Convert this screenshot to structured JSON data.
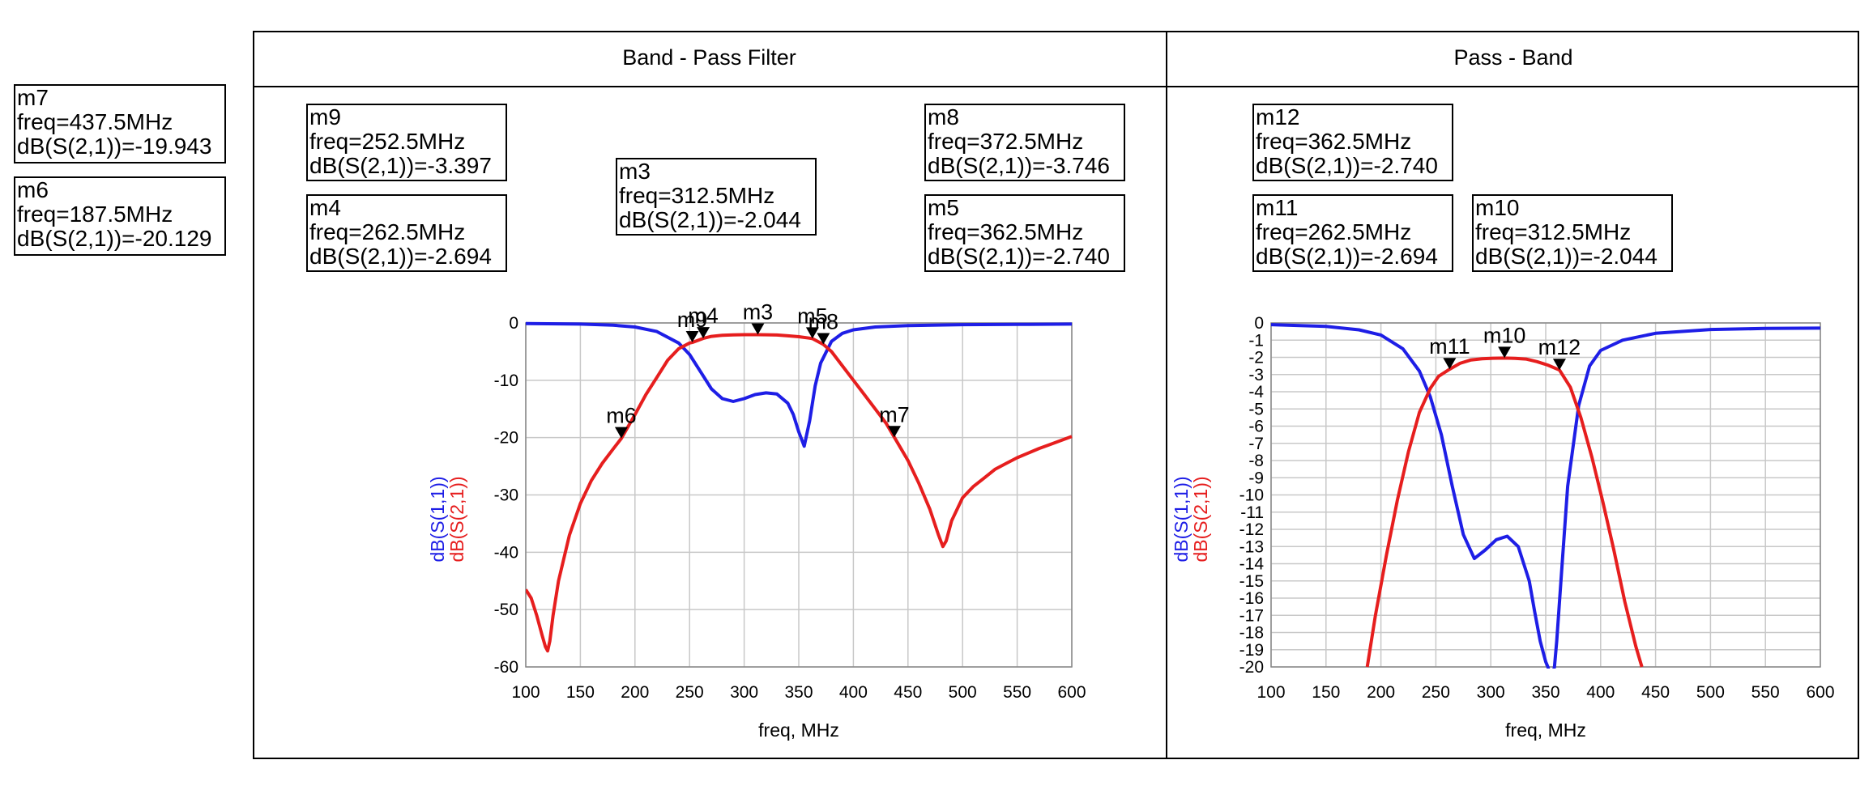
{
  "panels": [
    {
      "title": "Band - Pass Filter"
    },
    {
      "title": "Pass - Band"
    }
  ],
  "markers": {
    "m7": {
      "name": "m7",
      "freq": "freq=437.5MHz",
      "val": "dB(S(2,1))=-19.943"
    },
    "m6": {
      "name": "m6",
      "freq": "freq=187.5MHz",
      "val": "dB(S(2,1))=-20.129"
    },
    "m9": {
      "name": "m9",
      "freq": "freq=252.5MHz",
      "val": "dB(S(2,1))=-3.397"
    },
    "m4": {
      "name": "m4",
      "freq": "freq=262.5MHz",
      "val": "dB(S(2,1))=-2.694"
    },
    "m3": {
      "name": "m3",
      "freq": "freq=312.5MHz",
      "val": "dB(S(2,1))=-2.044"
    },
    "m8": {
      "name": "m8",
      "freq": "freq=372.5MHz",
      "val": "dB(S(2,1))=-3.746"
    },
    "m5": {
      "name": "m5",
      "freq": "freq=362.5MHz",
      "val": "dB(S(2,1))=-2.740"
    },
    "m12": {
      "name": "m12",
      "freq": "freq=362.5MHz",
      "val": "dB(S(2,1))=-2.740"
    },
    "m11": {
      "name": "m11",
      "freq": "freq=262.5MHz",
      "val": "dB(S(2,1))=-2.694"
    },
    "m10": {
      "name": "m10",
      "freq": "freq=312.5MHz",
      "val": "dB(S(2,1))=-2.044"
    }
  },
  "colors": {
    "s11": "#1e1ee6",
    "s21": "#e61e1e",
    "grid": "#c8c8c8"
  },
  "chart_data": [
    {
      "type": "line",
      "title": "Band - Pass Filter",
      "xlabel": "freq, MHz",
      "ylabel_series": [
        "dB(S(1,1))",
        "dB(S(2,1))"
      ],
      "xlim": [
        100,
        600
      ],
      "ylim": [
        -60,
        0
      ],
      "xticks": [
        100,
        150,
        200,
        250,
        300,
        350,
        400,
        450,
        500,
        550,
        600
      ],
      "yticks": [
        0,
        -10,
        -20,
        -30,
        -40,
        -50,
        -60
      ],
      "grid": true,
      "series": [
        {
          "name": "dB(S(1,1))",
          "color": "#1e1ee6",
          "x": [
            100,
            150,
            180,
            200,
            220,
            240,
            250,
            260,
            270,
            280,
            290,
            300,
            310,
            320,
            330,
            340,
            345,
            350,
            355,
            360,
            365,
            370,
            380,
            390,
            400,
            420,
            450,
            500,
            550,
            600
          ],
          "y": [
            -0.1,
            -0.2,
            -0.4,
            -0.7,
            -1.5,
            -3.5,
            -5.5,
            -8.5,
            -11.5,
            -13.2,
            -13.7,
            -13.2,
            -12.5,
            -12.2,
            -12.4,
            -14.0,
            -16.0,
            -19.0,
            -21.5,
            -17.0,
            -11.0,
            -7.0,
            -3.2,
            -1.8,
            -1.2,
            -0.7,
            -0.45,
            -0.3,
            -0.25,
            -0.2
          ]
        },
        {
          "name": "dB(S(2,1))",
          "color": "#e61e1e",
          "x": [
            100,
            105,
            110,
            115,
            118,
            120,
            122,
            125,
            130,
            140,
            150,
            160,
            170,
            180,
            187.5,
            200,
            210,
            220,
            230,
            240,
            250,
            252.5,
            262.5,
            270,
            280,
            290,
            300,
            312.5,
            320,
            330,
            340,
            350,
            360,
            362.5,
            372.5,
            380,
            390,
            400,
            410,
            420,
            430,
            437.5,
            450,
            460,
            470,
            478,
            482,
            485,
            490,
            500,
            510,
            520,
            530,
            540,
            550,
            560,
            570,
            580,
            590,
            600
          ],
          "y": [
            -46.5,
            -48,
            -51,
            -54.5,
            -56.5,
            -57.2,
            -55.5,
            -51,
            -45,
            -37,
            -31.5,
            -27.5,
            -24.5,
            -22,
            -20.129,
            -16,
            -12.5,
            -9.5,
            -6.5,
            -4.5,
            -3.5,
            -3.397,
            -2.694,
            -2.35,
            -2.15,
            -2.08,
            -2.05,
            -2.044,
            -2.06,
            -2.1,
            -2.25,
            -2.4,
            -2.65,
            -2.74,
            -3.746,
            -5.0,
            -7.5,
            -10.0,
            -12.5,
            -15.0,
            -17.5,
            -19.943,
            -24,
            -28,
            -32.5,
            -37,
            -39,
            -38,
            -34.5,
            -30.5,
            -28.5,
            -27,
            -25.5,
            -24.5,
            -23.5,
            -22.7,
            -21.9,
            -21.2,
            -20.5,
            -19.8
          ]
        }
      ],
      "markers": [
        {
          "name": "m9",
          "x": 252.5,
          "y": -3.397
        },
        {
          "name": "m4",
          "x": 262.5,
          "y": -2.694
        },
        {
          "name": "m3",
          "x": 312.5,
          "y": -2.044
        },
        {
          "name": "m5",
          "x": 362.5,
          "y": -2.74
        },
        {
          "name": "m8",
          "x": 372.5,
          "y": -3.746
        },
        {
          "name": "m6",
          "x": 187.5,
          "y": -20.129
        },
        {
          "name": "m7",
          "x": 437.5,
          "y": -19.943
        }
      ]
    },
    {
      "type": "line",
      "title": "Pass - Band",
      "xlabel": "freq, MHz",
      "ylabel_series": [
        "dB(S(1,1))",
        "dB(S(2,1))"
      ],
      "xlim": [
        100,
        600
      ],
      "ylim": [
        -20,
        0
      ],
      "xticks": [
        100,
        150,
        200,
        250,
        300,
        350,
        400,
        450,
        500,
        550,
        600
      ],
      "yticks": [
        0,
        -1,
        -2,
        -3,
        -4,
        -5,
        -6,
        -7,
        -8,
        -9,
        -10,
        -11,
        -12,
        -13,
        -14,
        -15,
        -16,
        -17,
        -18,
        -19,
        -20
      ],
      "grid": true,
      "series": [
        {
          "name": "dB(S(1,1))",
          "color": "#1e1ee6",
          "x": [
            100,
            150,
            180,
            200,
            220,
            235,
            245,
            255,
            265,
            275,
            285,
            295,
            305,
            315,
            325,
            335,
            340,
            345,
            350,
            352,
            354,
            356,
            358,
            360,
            365,
            370,
            380,
            390,
            400,
            420,
            450,
            500,
            550,
            600
          ],
          "y": [
            -0.1,
            -0.2,
            -0.4,
            -0.7,
            -1.5,
            -2.8,
            -4.3,
            -6.5,
            -9.5,
            -12.3,
            -13.7,
            -13.2,
            -12.6,
            -12.4,
            -13.0,
            -15.0,
            -16.8,
            -18.5,
            -19.7,
            -20,
            -20.5,
            -20.5,
            -20,
            -18.5,
            -14.0,
            -9.5,
            -4.8,
            -2.5,
            -1.6,
            -1.0,
            -0.6,
            -0.38,
            -0.32,
            -0.3
          ]
        },
        {
          "name": "dB(S(2,1))",
          "color": "#e61e1e",
          "x": [
            187.5,
            195,
            205,
            215,
            225,
            235,
            245,
            252.5,
            262.5,
            272,
            282,
            292,
            302,
            312.5,
            322,
            332,
            342,
            352,
            362.5,
            372.5,
            382,
            392,
            402,
            412,
            422,
            432,
            437.5
          ],
          "y": [
            -20,
            -17,
            -13.5,
            -10.3,
            -7.5,
            -5.2,
            -3.8,
            -3.1,
            -2.694,
            -2.35,
            -2.15,
            -2.08,
            -2.05,
            -2.044,
            -2.06,
            -2.1,
            -2.25,
            -2.45,
            -2.74,
            -3.746,
            -5.5,
            -7.8,
            -10.4,
            -13.2,
            -16.2,
            -18.8,
            -20
          ]
        }
      ],
      "markers": [
        {
          "name": "m11",
          "x": 262.5,
          "y": -2.694
        },
        {
          "name": "m10",
          "x": 312.5,
          "y": -2.044
        },
        {
          "name": "m12",
          "x": 362.5,
          "y": -2.74
        }
      ]
    }
  ]
}
